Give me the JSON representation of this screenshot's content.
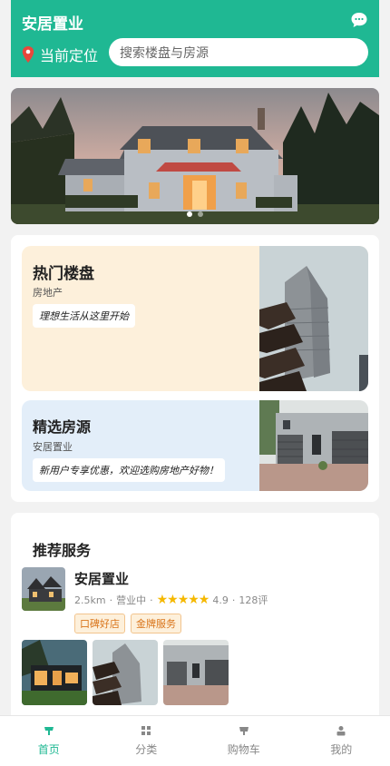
{
  "header": {
    "brand": "安居置业",
    "location_label": "当前定位",
    "search_placeholder": "搜索楼盘与房源",
    "chat_icon": "chat-bubble-icon",
    "location_icon": "location-pin-icon"
  },
  "banner": {
    "slides": 2,
    "active_slide": 1
  },
  "featured": {
    "hot": {
      "title": "热门楼盘",
      "subtitle": "房地产",
      "tag": "理想生活从这里开始"
    },
    "pick": {
      "title": "精选房源",
      "subtitle": "安居置业",
      "tag": "新用户专享优惠，欢迎选购房地产好物！"
    }
  },
  "services": {
    "heading": "推荐服务",
    "shop": {
      "name": "安居置业",
      "distance": "2.5km",
      "status": "营业中",
      "sep": "·",
      "stars": "★★★★★",
      "rating": "4.9",
      "reviews": "128评",
      "badges": [
        "口碑好店",
        "金牌服务"
      ]
    }
  },
  "tabs": [
    {
      "label": "首页",
      "icon": "home-icon",
      "active": true
    },
    {
      "label": "分类",
      "icon": "grid-icon",
      "active": false
    },
    {
      "label": "购物车",
      "icon": "cart-icon",
      "active": false
    },
    {
      "label": "我的",
      "icon": "user-icon",
      "active": false
    }
  ],
  "colors": {
    "accent": "#1fb893",
    "star": "#f5b800",
    "badge_text": "#d9741a"
  }
}
